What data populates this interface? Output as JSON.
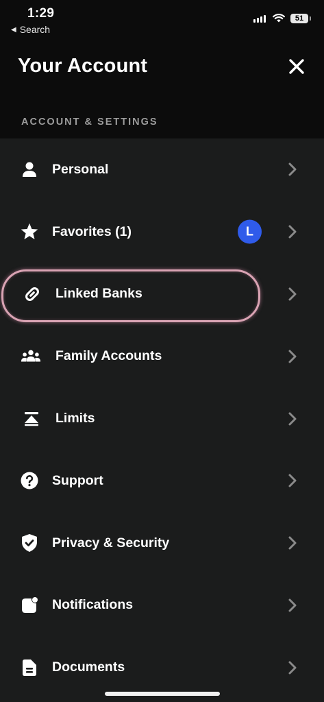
{
  "status_bar": {
    "time": "1:29",
    "back_label": "Search",
    "battery": "51"
  },
  "header": {
    "title": "Your Account"
  },
  "section": {
    "title": "ACCOUNT & SETTINGS"
  },
  "menu": {
    "items": [
      {
        "label": "Personal",
        "icon": "person-icon"
      },
      {
        "label": "Favorites (1)",
        "icon": "star-icon",
        "badge": "L"
      },
      {
        "label": "Linked Banks",
        "icon": "link-icon",
        "highlighted": true
      },
      {
        "label": "Family Accounts",
        "icon": "family-icon"
      },
      {
        "label": "Limits",
        "icon": "limits-icon"
      },
      {
        "label": "Support",
        "icon": "help-icon"
      },
      {
        "label": "Privacy & Security",
        "icon": "shield-icon"
      },
      {
        "label": "Notifications",
        "icon": "notification-icon"
      },
      {
        "label": "Documents",
        "icon": "document-icon"
      }
    ]
  },
  "colors": {
    "background": "#1b1c1c",
    "header_background": "#0c0c0c",
    "badge": "#2f5bea",
    "highlight_ring": "#d9a3b3"
  }
}
